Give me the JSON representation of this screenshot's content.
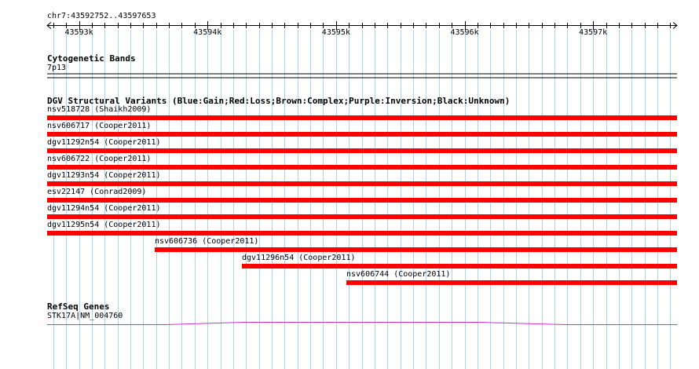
{
  "ruler": {
    "range_label": "chr7:43592752..43597653",
    "ticks": [
      {
        "label": "43593k",
        "pos": 43593000
      },
      {
        "label": "43594k",
        "pos": 43594000
      },
      {
        "label": "43595k",
        "pos": 43595000
      },
      {
        "label": "43596k",
        "pos": 43596000
      },
      {
        "label": "43597k",
        "pos": 43597000
      }
    ],
    "start": 43592752,
    "end": 43597653
  },
  "tracks": {
    "cytobands": {
      "title": "Cytogenetic Bands",
      "band_label": "7p13"
    },
    "dgv": {
      "title": "DGV Structural Variants (Blue:Gain;Red:Loss;Brown:Complex;Purple:Inversion;Black:Unknown)",
      "bar_color": "#ff0000",
      "features": [
        {
          "label": "nsv518728 (Shaikh2009)",
          "start": 43592700,
          "end": 43597653,
          "type": "Loss"
        },
        {
          "label": "nsv606717 (Cooper2011)",
          "start": 43592700,
          "end": 43597653,
          "type": "Loss"
        },
        {
          "label": "dgv11292n54 (Cooper2011)",
          "start": 43592700,
          "end": 43597653,
          "type": "Loss"
        },
        {
          "label": "nsv606722 (Cooper2011)",
          "start": 43592700,
          "end": 43597653,
          "type": "Loss"
        },
        {
          "label": "dgv11293n54 (Cooper2011)",
          "start": 43592700,
          "end": 43597653,
          "type": "Loss"
        },
        {
          "label": "esv22147 (Conrad2009)",
          "start": 43592700,
          "end": 43597653,
          "type": "Loss"
        },
        {
          "label": "dgv11294n54 (Cooper2011)",
          "start": 43592700,
          "end": 43597653,
          "type": "Loss"
        },
        {
          "label": "dgv11295n54 (Cooper2011)",
          "start": 43592700,
          "end": 43597653,
          "type": "Loss"
        },
        {
          "label": "nsv606736 (Cooper2011)",
          "start": 43593590,
          "end": 43597653,
          "type": "Loss"
        },
        {
          "label": "dgv11296n54 (Cooper2011)",
          "start": 43594270,
          "end": 43597653,
          "type": "Loss"
        },
        {
          "label": "nsv606744 (Cooper2011)",
          "start": 43595080,
          "end": 43597653,
          "type": "Loss"
        }
      ]
    },
    "refseq": {
      "title": "RefSeq Genes",
      "gene_label": "STK17A|NM_004760",
      "color": "#cc33cc"
    }
  },
  "colors": {
    "grid": "#aad4ee",
    "loss": "#ff0000",
    "gene": "#cc33cc"
  }
}
